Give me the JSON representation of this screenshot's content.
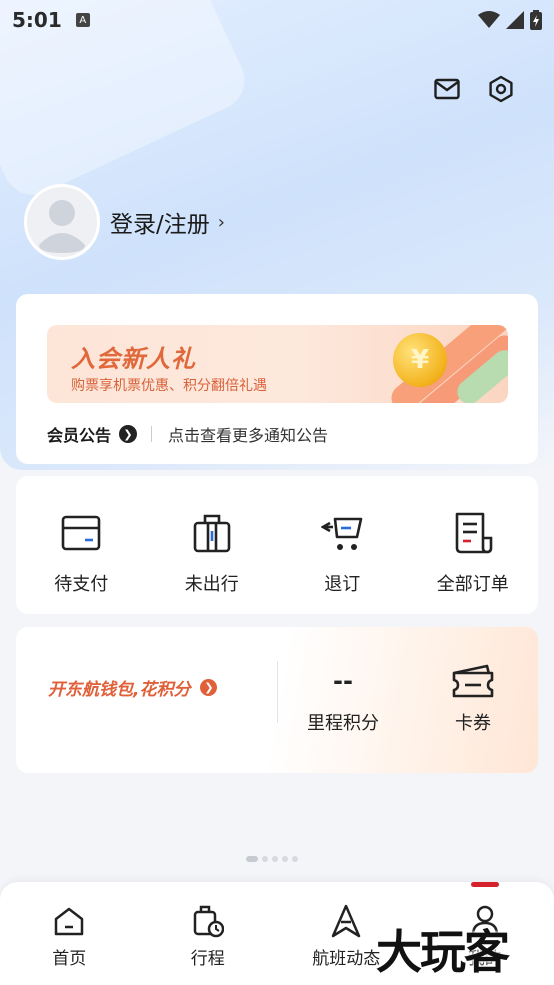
{
  "status_bar": {
    "time": "5:01",
    "notification_glyph": "A"
  },
  "header": {
    "icons": [
      "mail-icon",
      "settings-icon"
    ]
  },
  "profile": {
    "login_label": "登录/注册",
    "chevron": "›"
  },
  "promo": {
    "title": "入会新人礼",
    "subtitle": "购票享机票优惠、积分翻倍礼遇",
    "coin_symbol": "¥"
  },
  "notice": {
    "label": "会员公告",
    "text": "点击查看更多通知公告"
  },
  "orders": [
    {
      "label": "待支付",
      "icon": "wallet-card-icon"
    },
    {
      "label": "未出行",
      "icon": "luggage-icon"
    },
    {
      "label": "退订",
      "icon": "cart-return-icon"
    },
    {
      "label": "全部订单",
      "icon": "order-list-icon"
    }
  ],
  "wallet": {
    "promo_text": "开东航钱包,花积分",
    "mileage": {
      "value": "--",
      "label": "里程积分"
    },
    "coupons": {
      "label": "卡券",
      "icon": "ticket-icon"
    }
  },
  "carousel": {
    "count": 5,
    "active_index": 0
  },
  "tabbar": {
    "tabs": [
      {
        "label": "首页",
        "icon": "home-icon"
      },
      {
        "label": "行程",
        "icon": "itinerary-icon"
      },
      {
        "label": "航班动态",
        "icon": "flight-status-icon"
      },
      {
        "label": "我的",
        "icon": "profile-icon",
        "active": true
      }
    ]
  },
  "watermark": {
    "text": "大玩客"
  },
  "colors": {
    "accent_orange": "#e0603a",
    "tab_indicator": "#d5212c",
    "promo_orange": "#e0683a"
  }
}
